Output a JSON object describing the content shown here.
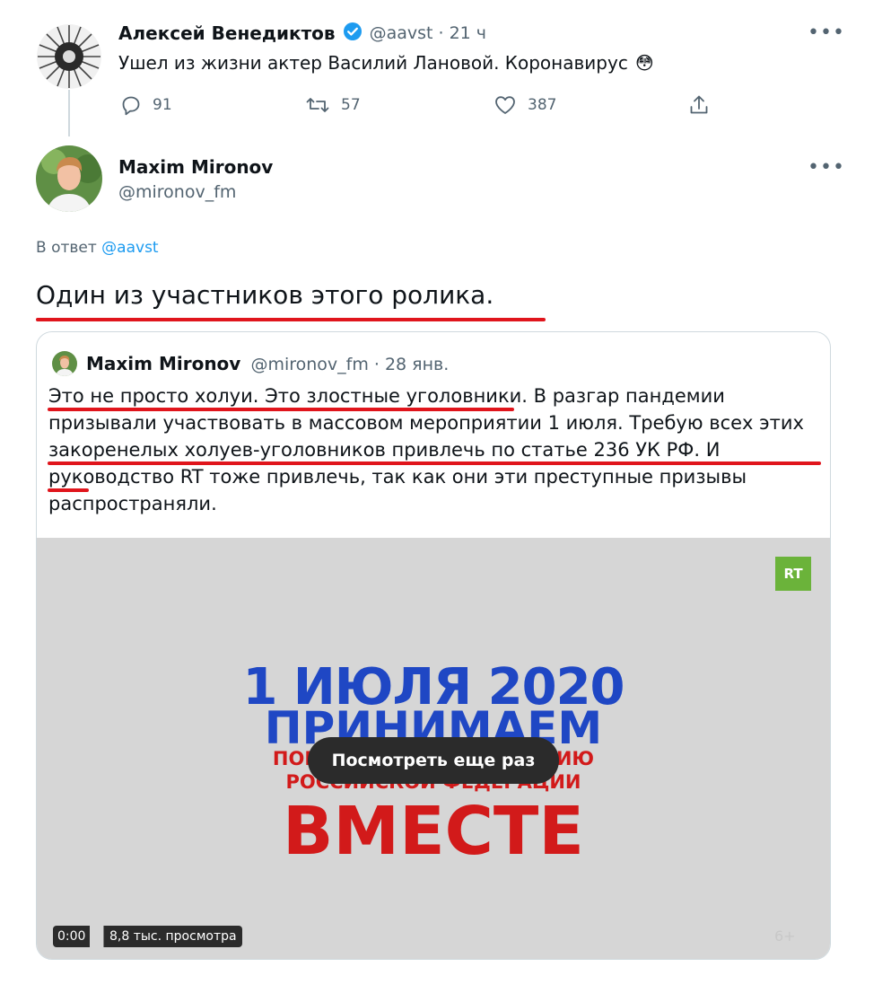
{
  "tweet1": {
    "author_name": "Алексей Венедиктов",
    "handle_time": "@aavst · 21 ч",
    "text": "Ушел из жизни актер Василий Лановой. Коронавирус",
    "emoji": "😳",
    "replies": "91",
    "retweets": "57",
    "likes": "387"
  },
  "tweet2": {
    "author_name": "Maxim Mironov",
    "handle": "@mironov_fm",
    "reply_prefix": "В ответ",
    "reply_to": "@aavst",
    "text": "Один из участников этого ролика."
  },
  "quoted": {
    "author_name": "Maxim Mironov",
    "handle_time": "@mironov_fm · 28 янв.",
    "text": "Это не просто холуи. Это злостные уголовники. В разгар пандемии призывали участвовать в массовом мероприятии 1 июля. Требую всех этих закоренелых холуев-уголовников привлечь по статье 236 УК РФ. И руководство RT тоже привлечь, так как они эти преступные призывы распространяли."
  },
  "video": {
    "logo": "RT",
    "line1": "1 ИЮЛЯ 2020",
    "line2": "ПРИНИМАЕМ",
    "line3": "ПОПРАВКИ В КОНСТИТУЦИЮ",
    "line4": "РОССИЙСКОЙ ФЕДЕРАЦИИ",
    "line5": "ВМЕСТЕ",
    "replay_label": "Посмотреть еще раз",
    "time": "0:00",
    "views": "8,8 тыс. просмотра",
    "age_rating": "6+"
  },
  "colors": {
    "accent": "#1d9bf0",
    "underline": "#e0151c",
    "video_blue": "#1f47c4",
    "video_red": "#d21a1a",
    "rt_green": "#6bb33a"
  },
  "icons": {
    "verified": "verified-badge-icon",
    "reply": "reply-icon",
    "retweet": "retweet-icon",
    "like": "heart-icon",
    "share": "share-icon",
    "more": "more-icon"
  }
}
